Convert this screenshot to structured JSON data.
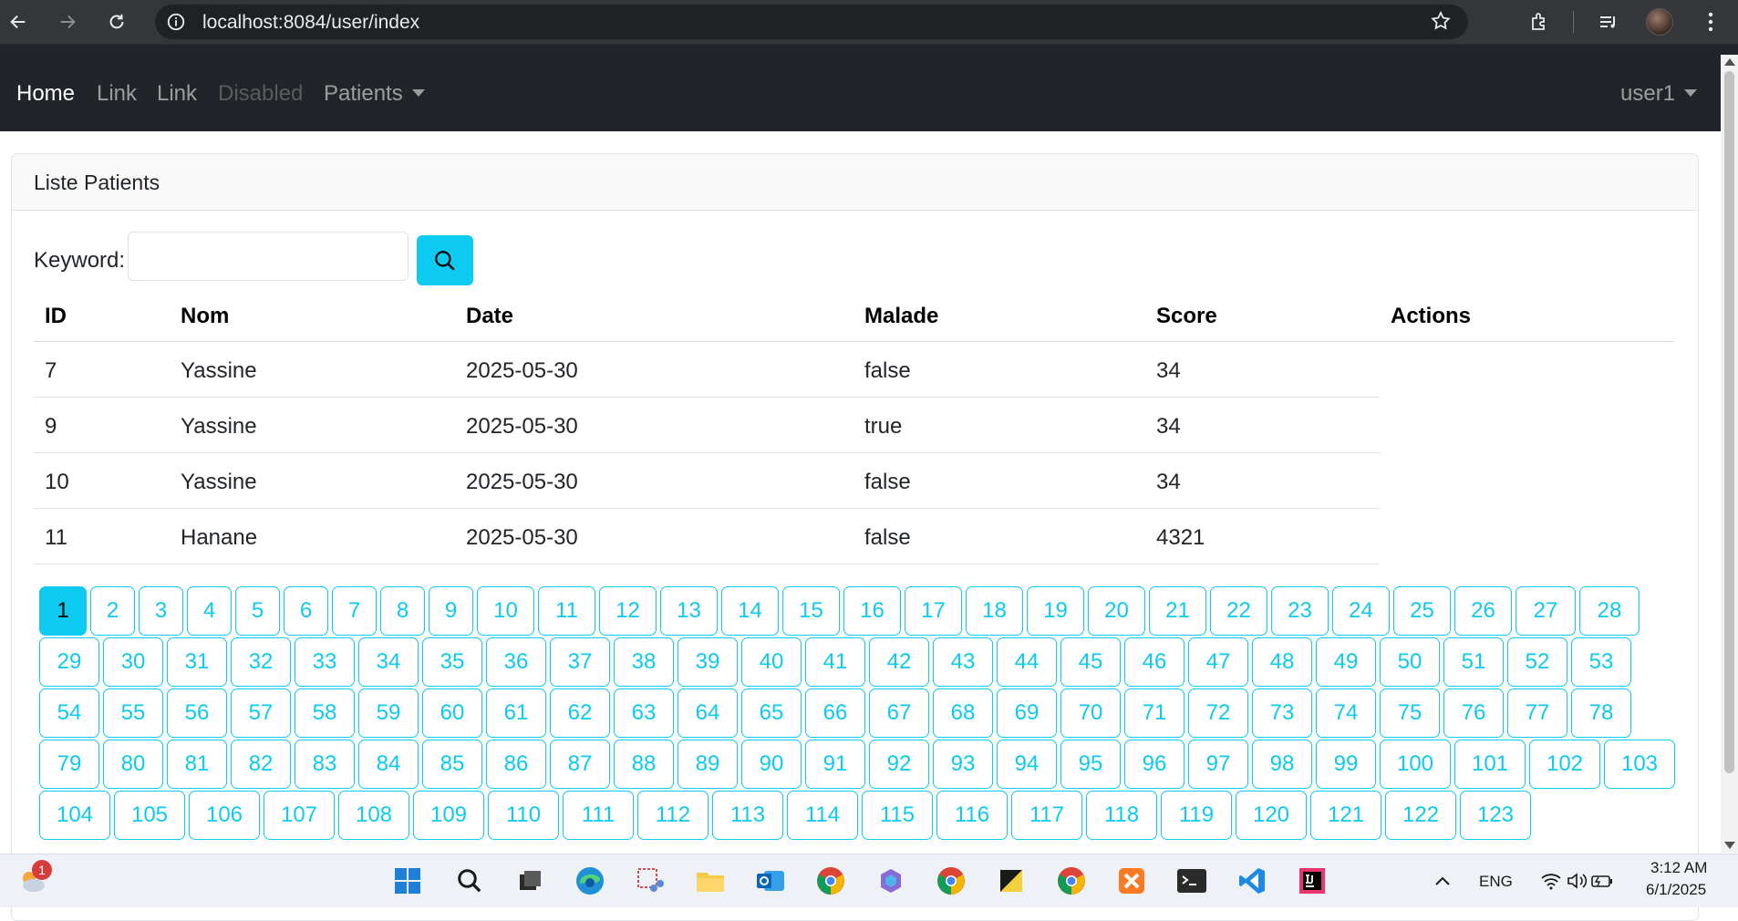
{
  "browser": {
    "url": "localhost:8084/user/index"
  },
  "navbar": {
    "links": [
      "Home",
      "Link",
      "Link",
      "Disabled",
      "Patients"
    ],
    "user": "user1"
  },
  "card": {
    "title": "Liste Patients"
  },
  "search": {
    "label": "Keyword:",
    "value": "",
    "placeholder": "",
    "button_icon": "search-icon"
  },
  "table": {
    "headers": [
      "ID",
      "Nom",
      "Date",
      "Malade",
      "Score",
      "Actions"
    ],
    "rows": [
      [
        "7",
        "Yassine",
        "2025-05-30",
        "false",
        "34"
      ],
      [
        "9",
        "Yassine",
        "2025-05-30",
        "true",
        "34"
      ],
      [
        "10",
        "Yassine",
        "2025-05-30",
        "false",
        "34"
      ],
      [
        "11",
        "Hanane",
        "2025-05-30",
        "false",
        "4321"
      ]
    ]
  },
  "pagination": {
    "current": 1,
    "visible_pages": [
      "1",
      "2",
      "3",
      "4",
      "5",
      "6",
      "7",
      "8",
      "9",
      "10",
      "11",
      "12",
      "13",
      "14",
      "15",
      "16",
      "17",
      "18",
      "19",
      "20",
      "21",
      "22",
      "23",
      "24",
      "25",
      "26",
      "27",
      "28",
      "29",
      "30",
      "31",
      "32",
      "33",
      "34",
      "35",
      "36",
      "37",
      "38",
      "39",
      "40",
      "41",
      "42",
      "43",
      "44",
      "45",
      "46",
      "47",
      "48",
      "49",
      "50",
      "51",
      "52",
      "53",
      "54",
      "55",
      "56",
      "57",
      "58",
      "59",
      "60",
      "61",
      "62",
      "63",
      "64",
      "65",
      "66",
      "67",
      "68",
      "69",
      "70",
      "71",
      "72",
      "73",
      "74",
      "75",
      "76",
      "77",
      "78",
      "79",
      "80",
      "81",
      "82",
      "83",
      "84",
      "85",
      "86",
      "87",
      "88",
      "89",
      "90",
      "91",
      "92",
      "93",
      "94",
      "95",
      "96",
      "97",
      "98",
      "99",
      "100",
      "101",
      "102",
      "103",
      "104",
      "105",
      "106",
      "107",
      "108",
      "109",
      "110",
      "111",
      "112",
      "113",
      "114",
      "115",
      "116",
      "117",
      "118",
      "119",
      "120",
      "121",
      "122",
      "123"
    ]
  },
  "taskbar": {
    "notification_count": "1",
    "language": "ENG",
    "time": "3:12 AM",
    "date": "6/1/2025"
  },
  "colors": {
    "accent": "#0dcaf0",
    "navbar_bg": "#212529",
    "chrome_bg": "#35363a"
  }
}
